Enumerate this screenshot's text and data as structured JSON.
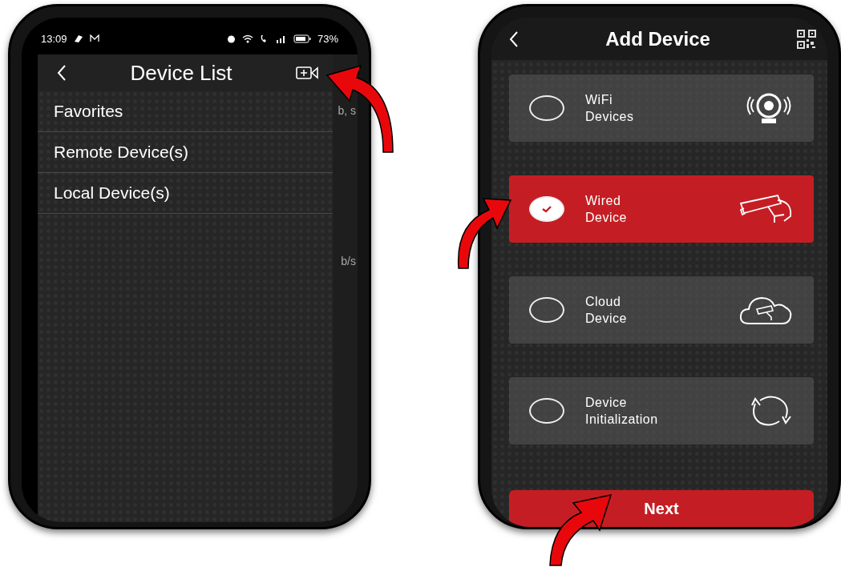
{
  "device_list_screen": {
    "status_bar": {
      "time": "13:09",
      "battery": "73%"
    },
    "title": "Device List",
    "menu_items": [
      {
        "label": "Favorites"
      },
      {
        "label": "Remote Device(s)"
      },
      {
        "label": "Local Device(s)"
      }
    ],
    "background_fragments": [
      "b, s",
      "b/s"
    ]
  },
  "add_device_screen": {
    "title": "Add Device",
    "options": [
      {
        "label": "WiFi Devices",
        "kind": "wifi",
        "selected": false
      },
      {
        "label": "Wired Device",
        "kind": "wired",
        "selected": true
      },
      {
        "label": "Cloud Device",
        "kind": "cloud",
        "selected": false
      },
      {
        "label": "Device Initialization",
        "kind": "init",
        "selected": false
      }
    ],
    "button": "Next"
  }
}
